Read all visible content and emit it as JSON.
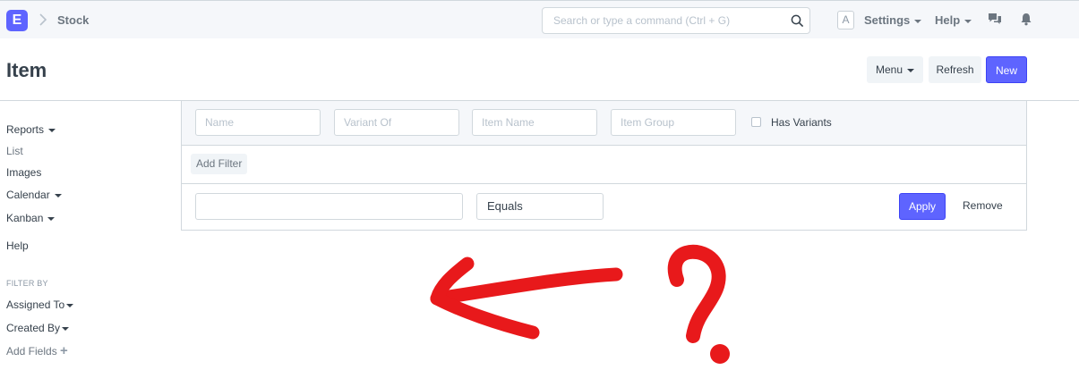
{
  "navbar": {
    "logo_letter": "E",
    "breadcrumb": "Stock",
    "search_placeholder": "Search or type a command (Ctrl + G)",
    "avatar_letter": "A",
    "settings_label": "Settings",
    "help_label": "Help",
    "icons": [
      "search-icon",
      "chat-icon",
      "bell-icon"
    ]
  },
  "page": {
    "title": "Item",
    "menu_label": "Menu",
    "refresh_label": "Refresh",
    "new_label": "New"
  },
  "sidebar": {
    "items": [
      {
        "label": "Reports",
        "dropdown": true
      },
      {
        "label": "List",
        "dropdown": false
      },
      {
        "label": "Images",
        "dropdown": false
      },
      {
        "label": "Calendar",
        "dropdown": true
      },
      {
        "label": "Kanban",
        "dropdown": true
      },
      {
        "label": "Help",
        "dropdown": false
      }
    ],
    "filter_by_heading": "FILTER BY",
    "filter_items": [
      {
        "label": "Assigned To",
        "dropdown": true
      },
      {
        "label": "Created By",
        "dropdown": true
      }
    ],
    "add_fields_label": "Add Fields",
    "add_fields_icon": "+"
  },
  "filters": {
    "standard": [
      {
        "placeholder": "Name"
      },
      {
        "placeholder": "Variant Of"
      },
      {
        "placeholder": "Item Name"
      },
      {
        "placeholder": "Item Group"
      }
    ],
    "checkbox_label": "Has Variants",
    "checkbox_checked": false,
    "add_filter_label": "Add Filter",
    "edit": {
      "field_value": "",
      "condition": "Equals",
      "apply_label": "Apply",
      "remove_label": "Remove"
    }
  },
  "annotation": {
    "question_mark": "?",
    "color": "#e8191b"
  },
  "colors": {
    "primary": "#5e64ff",
    "navbar_bg": "#f5f7fa",
    "border": "#d1d8dd"
  }
}
